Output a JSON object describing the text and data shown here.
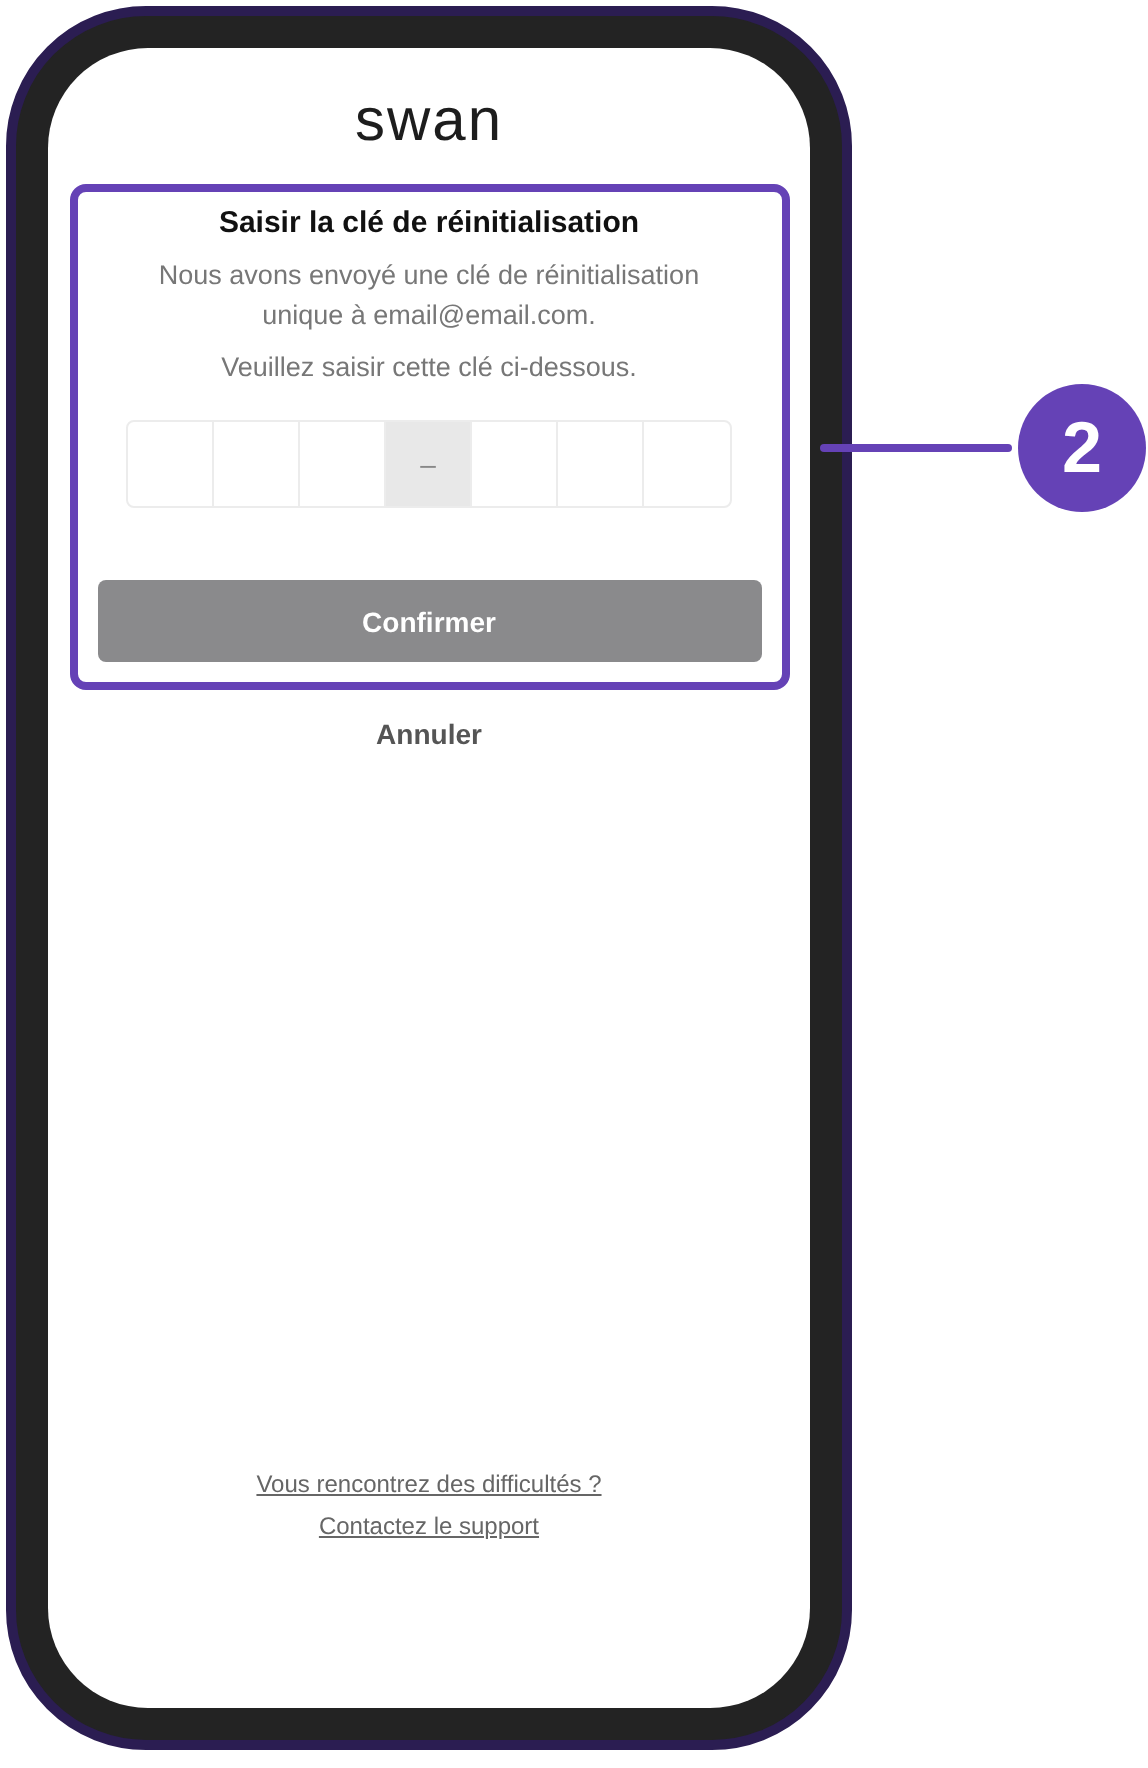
{
  "logo": "swan",
  "card": {
    "title": "Saisir la clé de réinitialisation",
    "paragraphs": [
      "Nous avons envoyé une clé de réinitialisation unique à email@email.com.",
      "Veuillez saisir cette clé ci-dessous."
    ],
    "code_cells": [
      {
        "kind": "empty"
      },
      {
        "kind": "empty"
      },
      {
        "kind": "empty"
      },
      {
        "kind": "separator",
        "text": "–"
      },
      {
        "kind": "empty"
      },
      {
        "kind": "empty"
      },
      {
        "kind": "empty"
      }
    ],
    "confirm_button": "Confirmer"
  },
  "cancel_link": "Annuler",
  "help_links": [
    "Vous rencontrez des difficultés ?",
    "Contactez le support"
  ],
  "callout": {
    "number": "2"
  }
}
